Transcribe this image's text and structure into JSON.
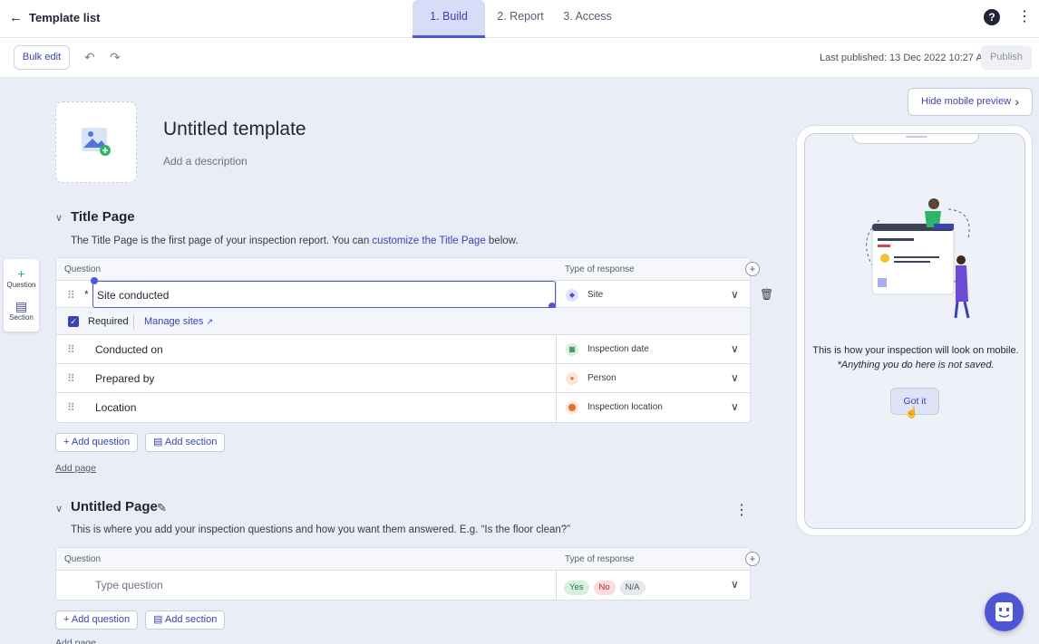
{
  "header": {
    "back_label": "Template list",
    "tabs": [
      {
        "label": "1. Build",
        "active": true
      },
      {
        "label": "2. Report",
        "active": false
      },
      {
        "label": "3. Access",
        "active": false
      }
    ]
  },
  "toolbar": {
    "bulk_edit_label": "Bulk edit",
    "last_published": "Last published: 13 Dec 2022 10:27 AM",
    "publish_label": "Publish"
  },
  "template": {
    "title": "Untitled template",
    "description_placeholder": "Add a description"
  },
  "title_page": {
    "heading": "Title Page",
    "desc_before": "The Title Page is the first page of your inspection report. You can ",
    "desc_link": "customize the Title Page",
    "desc_after": " below.",
    "col_question": "Question",
    "col_response": "Type of response",
    "rows": [
      {
        "question": "Site conducted",
        "response": "Site"
      },
      {
        "question": "Conducted on",
        "response": "Inspection date"
      },
      {
        "question": "Prepared by",
        "response": "Person"
      },
      {
        "question": "Location",
        "response": "Inspection location"
      }
    ],
    "required_label": "Required",
    "manage_sites_label": "Manage sites",
    "asterisk": "*"
  },
  "actions": {
    "add_question": "Add question",
    "add_section": "Add section",
    "add_page": "Add page"
  },
  "untitled_page": {
    "heading": "Untitled Page",
    "description": "This is where you add your inspection questions and how you want them answered. E.g. “Is the floor clean?”",
    "col_question": "Question",
    "col_response": "Type of response",
    "question_placeholder": "Type question",
    "responses": [
      "Yes",
      "No",
      "N/A"
    ]
  },
  "left_tools": {
    "question_label": "Question",
    "section_label": "Section"
  },
  "preview": {
    "hide_label": "Hide mobile preview",
    "text1": "This is how your inspection will look on mobile.",
    "text2": "*Anything you do here is not saved.",
    "got_it": "Got it"
  },
  "colors": {
    "accent": "#4e56d6",
    "link": "#3a43b4",
    "background": "#e9edf6"
  }
}
